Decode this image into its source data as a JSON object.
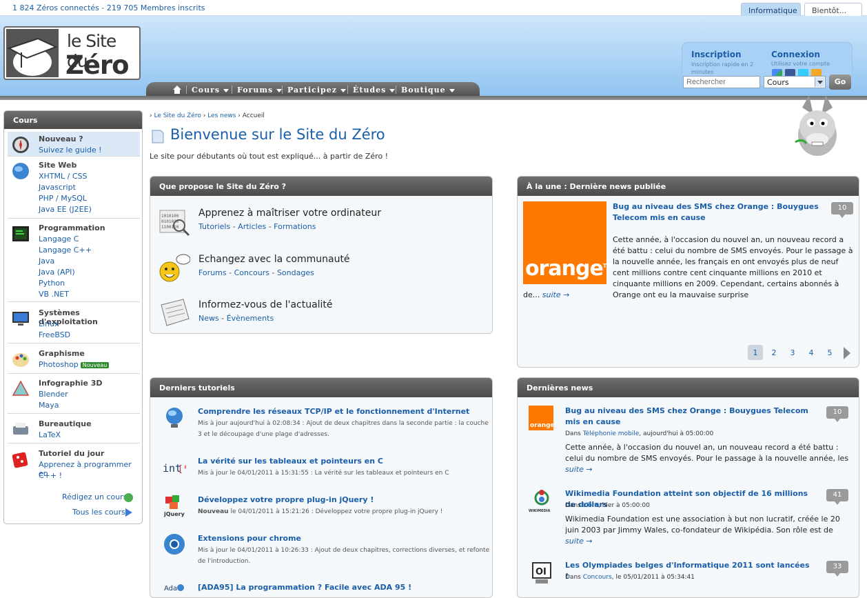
{
  "topbar": {
    "stats": "1 824 Zéros connectés - 219 705 Membres inscrits",
    "tab1": "Informatique",
    "tab2": "Bientôt..."
  },
  "logo": {
    "line1": "le Site du",
    "line2": "Zéro"
  },
  "nav": {
    "items": [
      "Cours",
      "Forums",
      "Participez",
      "Études",
      "Boutique"
    ]
  },
  "login": {
    "inscription": "Inscription",
    "inscription_desc": "Inscription rapide en 2 minutes",
    "connexion": "Connexion",
    "connexion_desc": "Utilisez votre compte"
  },
  "search": {
    "placeholder": "Rechercher",
    "select": "Cours",
    "go": "Go"
  },
  "sidebar": {
    "title": "Cours",
    "cats": [
      {
        "title": "Nouveau ?",
        "links": [
          "Suivez le guide !"
        ]
      },
      {
        "title": "Site Web",
        "links": [
          "XHTML / CSS",
          "Javascript",
          "PHP / MySQL",
          "Java EE (J2EE)"
        ]
      },
      {
        "title": "Programmation",
        "links": [
          "Langage C",
          "Langage C++",
          "Java",
          "Java (API)",
          "Python",
          "VB .NET"
        ]
      },
      {
        "title": "Systèmes d'exploitation",
        "links": [
          "Linux",
          "FreeBSD"
        ]
      },
      {
        "title": "Graphisme",
        "links": [
          "Photoshop"
        ],
        "badge": "Nouveau"
      },
      {
        "title": "Infographie 3D",
        "links": [
          "Blender",
          "Maya"
        ]
      },
      {
        "title": "Bureautique",
        "links": [
          "LaTeX"
        ]
      },
      {
        "title": "Tutoriel du jour",
        "links": [
          "Apprenez à programmer en",
          "C++ !"
        ]
      }
    ],
    "write": "Rédigez un cours",
    "all": "Tous les cours"
  },
  "breadcrumb": {
    "a": "Le Site du Zéro",
    "b": "Les news",
    "c": "Accueil"
  },
  "page": {
    "title": "Bienvenue sur le Site du Zéro",
    "subtitle": "Le site pour débutants où tout est expliqué... à partir de Zéro !"
  },
  "propose": {
    "title": "Que propose le Site du Zéro ?",
    "items": [
      {
        "title": "Apprenez à maîtriser votre ordinateur",
        "links": [
          "Tutoriels",
          "Articles",
          "Formations"
        ]
      },
      {
        "title": "Echangez avec la communauté",
        "links": [
          "Forums",
          "Concours",
          "Sondages"
        ]
      },
      {
        "title": "Informez-vous de l'actualité",
        "links": [
          "News",
          "Évènements"
        ]
      }
    ]
  },
  "une": {
    "title": "À la une : Dernière news publiée",
    "img_text": "orange",
    "news_title": "Bug au niveau des SMS chez Orange : Bouygues Telecom mis en cause",
    "count": "10",
    "text": "Cette année, à l'occasion du nouvel an, un nouveau record a été battu : celui du nombre de SMS envoyés. Pour le passage à la nouvelle année, les français en ont envoyés plus de neuf cent millions contre cent cinquante millions en 2010 et cinquante millions en 2009. Cependant, certains abonnés à Orange ont eu la mauvaise surprise",
    "tail": "de...",
    "more": "suite →",
    "pages": [
      "1",
      "2",
      "3",
      "4",
      "5"
    ]
  },
  "tutorials": {
    "title": "Derniers tutoriels",
    "items": [
      {
        "title": "Comprendre les réseaux TCP/IP et le fonctionnement d'Internet",
        "desc": "Mis à jour aujourd'hui à 02:08:34 : Ajout de deux chapitres dans la seconde partie : la couche 3 et le découpage d'une plage d'adresses."
      },
      {
        "title": "La vérité sur les tableaux et pointeurs en C",
        "desc": "Mis à jour le 04/01/2011 à 15:31:55 : La vérité sur les tableaux et pointeurs en C"
      },
      {
        "title": "Développez votre propre plug-in jQuery !",
        "strong": "Nouveau",
        "desc": " le 04/01/2011 à 15:21:26 : Développez votre propre plug-in jQuery !"
      },
      {
        "title": "Extensions pour chrome",
        "desc": "Mis à jour le 04/01/2011 à 10:26:33 : Ajout de deux chapitres, corrections diverses, et refonte de l'introduction."
      },
      {
        "title": "[ADA95] La programmation ? Facile avec ADA 95 !",
        "desc": ""
      }
    ]
  },
  "lastnews": {
    "title": "Dernières news",
    "items": [
      {
        "title": "Bug au niveau des SMS chez Orange : Bouygues Telecom mis en cause",
        "count": "10",
        "dans": "Dans ",
        "cat": "Téléphonie mobile",
        "when": ", aujourd'hui à 05:00:00",
        "text": "Cette année, à l'occasion du nouvel an, un nouveau record a été battu : celui du nombre de SMS envoyés. Pour le passage à la nouvelle année, les français en ont...",
        "more": "suite →"
      },
      {
        "title": "Wikimedia Foundation atteint son objectif de 16 millions de dollars",
        "count": "41",
        "dans": "Dans ",
        "cat": "Libre",
        "when": ", hier à 05:00:00",
        "text": "Wikimedia Foundation est une association à but non lucratif, créée le 20 juin 2003 par Jimmy Wales, co-fondateur de Wikipédia. Son rôle est de promouvoir la...",
        "more": "suite →",
        "logo": "WIKIMEDIA"
      },
      {
        "title": "Les Olympiades belges d'Informatique 2011 sont lancées !",
        "count": "33",
        "dans": "Dans ",
        "cat": "Concours",
        "when": ", le 05/01/2011 à 05:34:41",
        "logo": "OI"
      }
    ]
  },
  "colors": {
    "link": "#1a5ea8",
    "orange": "#ff7900",
    "header": "#8fc3f1"
  }
}
